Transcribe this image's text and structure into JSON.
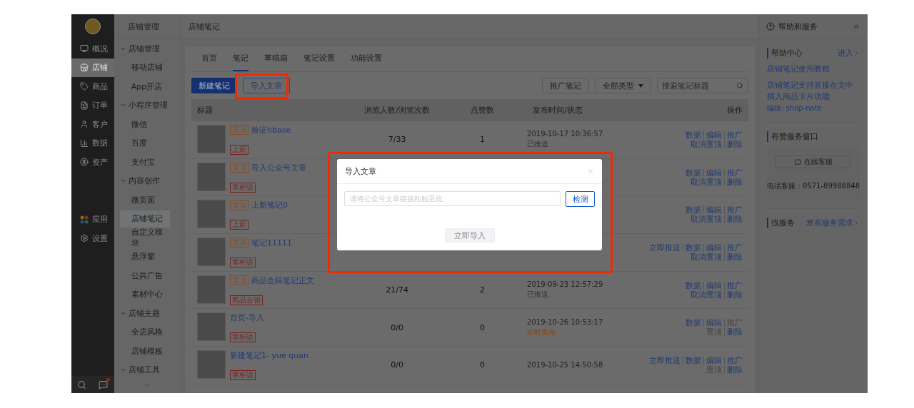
{
  "left_nav": {
    "items": [
      {
        "label": "概况",
        "selected": false
      },
      {
        "label": "店铺",
        "selected": true
      },
      {
        "label": "商品",
        "selected": false
      },
      {
        "label": "订单",
        "selected": false
      },
      {
        "label": "客户",
        "selected": false
      },
      {
        "label": "数据",
        "selected": false
      },
      {
        "label": "资产",
        "selected": false
      }
    ],
    "lower_items": [
      {
        "label": "应用",
        "selected": false
      },
      {
        "label": "设置",
        "selected": false
      }
    ]
  },
  "sub_nav": {
    "title": "店铺管理",
    "groups": [
      {
        "label": "店铺管理",
        "expanded": true,
        "children": [
          {
            "label": "移动店铺",
            "selected": false
          },
          {
            "label": "App开店",
            "selected": false
          }
        ]
      },
      {
        "label": "小程序管理",
        "expanded": true,
        "children": [
          {
            "label": "微信",
            "selected": false
          },
          {
            "label": "百度",
            "selected": false
          },
          {
            "label": "支付宝",
            "selected": false
          }
        ]
      },
      {
        "label": "内容创作",
        "expanded": true,
        "children": [
          {
            "label": "微页面",
            "selected": false
          },
          {
            "label": "店铺笔记",
            "selected": true
          },
          {
            "label": "自定义模块",
            "selected": false
          },
          {
            "label": "悬浮窗",
            "selected": false
          },
          {
            "label": "公共广告",
            "selected": false
          },
          {
            "label": "素材中心",
            "selected": false
          }
        ]
      },
      {
        "label": "店铺主题",
        "expanded": true,
        "children": [
          {
            "label": "全店风格",
            "selected": false
          },
          {
            "label": "店铺模板",
            "selected": false
          }
        ]
      },
      {
        "label": "店铺工具",
        "expanded": true
      }
    ]
  },
  "header": {
    "title": "店铺笔记"
  },
  "tabs": [
    {
      "label": "首页",
      "selected": false
    },
    {
      "label": "笔记",
      "selected": true
    },
    {
      "label": "草稿箱",
      "selected": false
    },
    {
      "label": "笔记设置",
      "selected": false
    },
    {
      "label": "功能设置",
      "selected": false
    }
  ],
  "toolbar": {
    "primary": "新建笔记",
    "secondary": "导入文章",
    "promote": "推广笔记",
    "type_filter": "全部类型",
    "search": {
      "placeholder": "搜索笔记标题"
    }
  },
  "table": {
    "columns": [
      "标题",
      "浏览人数/浏览次数",
      "点赞数",
      "发布时间/状态",
      "操作"
    ],
    "rows": [
      {
        "pin_tag": "置顶",
        "title": "验证hbase",
        "tag": "上新",
        "views": "7/33",
        "likes": "1",
        "time": "2019-10-17 10:36:57",
        "status": "已推送",
        "scheduled": false,
        "actions": [
          [
            {
              "label": "数据",
              "disabled": false
            },
            {
              "label": "编辑",
              "disabled": false
            },
            {
              "label": "推广",
              "disabled": false
            }
          ],
          [
            {
              "label": "取消置顶",
              "disabled": false
            },
            {
              "label": "删除",
              "disabled": false
            }
          ]
        ]
      },
      {
        "pin_tag": "置顶",
        "title": "导入公众号文章",
        "tag": "掌柜说",
        "actions": [
          [
            {
              "label": "数据",
              "disabled": false
            },
            {
              "label": "编辑",
              "disabled": false
            },
            {
              "label": "推广",
              "disabled": false
            }
          ],
          [
            {
              "label": "取消置顶",
              "disabled": false
            },
            {
              "label": "删除",
              "disabled": false
            }
          ]
        ]
      },
      {
        "pin_tag": "置顶",
        "title": "上新笔记0",
        "tag": "上新",
        "actions": [
          [
            {
              "label": "数据",
              "disabled": false
            },
            {
              "label": "编辑",
              "disabled": false
            },
            {
              "label": "推广",
              "disabled": false
            }
          ],
          [
            {
              "label": "取消置顶",
              "disabled": false
            },
            {
              "label": "删除",
              "disabled": false
            }
          ]
        ]
      },
      {
        "pin_tag": "置顶",
        "title": "笔记11111",
        "tag": "掌柜说",
        "actions": [
          [
            {
              "label": "立即推送",
              "disabled": false
            },
            {
              "label": "数据",
              "disabled": false
            },
            {
              "label": "编辑",
              "disabled": false
            },
            {
              "label": "推广",
              "disabled": false
            }
          ],
          [
            {
              "label": "取消置顶",
              "disabled": false
            },
            {
              "label": "删除",
              "disabled": false
            }
          ]
        ]
      },
      {
        "pin_tag": "置顶",
        "title": "商品合辑笔记正文",
        "tag": "商品合辑",
        "views": "21/74",
        "likes": "2",
        "time": "2019-09-23 12:57:29",
        "status": "已推送",
        "scheduled": false,
        "actions": [
          [
            {
              "label": "数据",
              "disabled": false
            },
            {
              "label": "编辑",
              "disabled": false
            },
            {
              "label": "推广",
              "disabled": false
            }
          ],
          [
            {
              "label": "取消置顶",
              "disabled": false
            },
            {
              "label": "删除",
              "disabled": false
            }
          ]
        ]
      },
      {
        "title": "首页-导入",
        "tag": "掌柜说",
        "views": "0/0",
        "likes": "0",
        "time": "2019-10-26 10:53:17",
        "status": "定时发布",
        "scheduled": true,
        "actions": [
          [
            {
              "label": "数据",
              "disabled": false
            },
            {
              "label": "编辑",
              "disabled": false
            },
            {
              "label": "推广",
              "disabled": true
            }
          ],
          [
            {
              "label": "置顶",
              "disabled": true
            },
            {
              "label": "删除",
              "disabled": false
            }
          ]
        ]
      },
      {
        "title": "新建笔记1- yue quan",
        "tag": "掌柜说",
        "views": "0/0",
        "likes": "0",
        "time": "2019-10-25 14:50:58",
        "actions": [
          [
            {
              "label": "立即推送",
              "disabled": false
            },
            {
              "label": "数据",
              "disabled": false
            },
            {
              "label": "编辑",
              "disabled": false
            },
            {
              "label": "推广",
              "disabled": false
            }
          ],
          [
            {
              "label": "置顶",
              "disabled": true
            },
            {
              "label": "删除",
              "disabled": false
            }
          ]
        ]
      }
    ]
  },
  "modal": {
    "title": "导入文章",
    "input": {
      "placeholder": "请将公众号文章链接粘贴至此"
    },
    "check_button": "检测",
    "submit": {
      "label": "立即导入",
      "disabled": true
    }
  },
  "help_panel": {
    "title": "帮助和服务",
    "help_center": {
      "title": "帮助中心",
      "more": "进入",
      "links": [
        "店铺笔记使用教程",
        "店铺笔记支持直接在文中插入商品卡片功能"
      ],
      "editor": "编辑: shop-note"
    },
    "service": {
      "title": "有赞服务窗口",
      "button": "在线客服",
      "phone": "电话客服：0571-89988848"
    },
    "find": {
      "title": "找服务",
      "link": "发布服务需求"
    }
  }
}
